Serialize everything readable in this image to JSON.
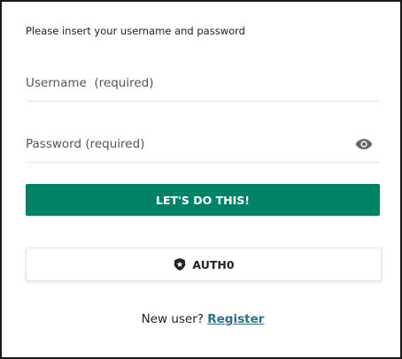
{
  "form": {
    "instructions": "Please insert your username and password",
    "username_placeholder": "Username  (required)",
    "password_placeholder": "Password (required)",
    "submit_label": "LET'S DO THIS!",
    "social_label": "AUTH0",
    "footer_text": "New user?",
    "register_label": "Register"
  },
  "colors": {
    "primary": "#008266",
    "link": "#2f6f8a"
  },
  "icons": {
    "password_toggle": "eye-icon",
    "social": "auth0-icon"
  }
}
